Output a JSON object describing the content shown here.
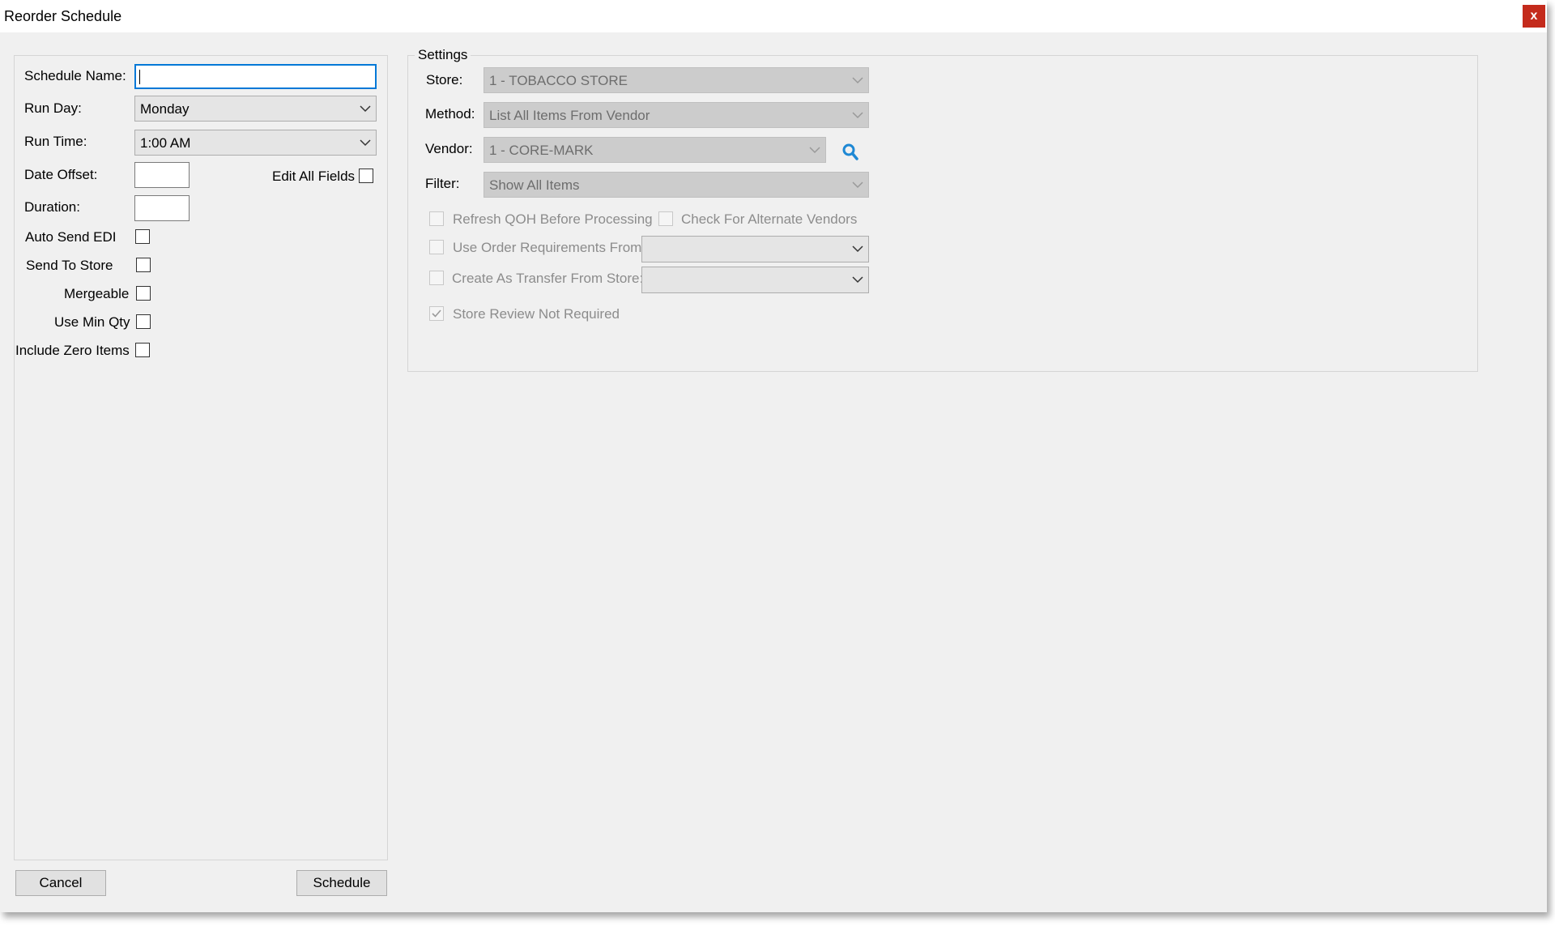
{
  "window": {
    "title": "Reorder Schedule",
    "close_label": "x"
  },
  "left": {
    "schedule_name_label": "Schedule Name:",
    "schedule_name_value": "",
    "run_day_label": "Run Day:",
    "run_day_value": "Monday",
    "run_time_label": "Run Time:",
    "run_time_value": "1:00 AM",
    "date_offset_label": "Date Offset:",
    "date_offset_value": "",
    "edit_all_fields_label": "Edit All Fields",
    "duration_label": "Duration:",
    "duration_value": "",
    "auto_send_edi_label": "Auto Send EDI",
    "send_to_store_label": "Send To Store",
    "mergeable_label": "Mergeable",
    "use_min_qty_label": "Use Min Qty",
    "include_zero_items_label": "Include Zero Items"
  },
  "settings": {
    "title": "Settings",
    "store_label": "Store:",
    "store_value": "1 - TOBACCO STORE",
    "method_label": "Method:",
    "method_value": "List All Items From Vendor",
    "vendor_label": "Vendor:",
    "vendor_value": "1 - CORE-MARK",
    "filter_label": "Filter:",
    "filter_value": "Show All Items",
    "refresh_qoh_label": "Refresh QOH Before Processing",
    "check_alt_vendors_label": "Check For Alternate Vendors",
    "use_order_req_label": "Use Order Requirements From:",
    "use_order_req_value": "",
    "create_transfer_label": "Create As Transfer From Store:",
    "create_transfer_value": "",
    "store_review_label": "Store Review Not Required"
  },
  "buttons": {
    "cancel": "Cancel",
    "schedule": "Schedule"
  },
  "colors": {
    "accent": "#0078d7",
    "close": "#c42b1c",
    "search_icon": "#1e88d4"
  },
  "state": {
    "edit_all_fields_checked": false,
    "auto_send_edi_checked": false,
    "send_to_store_checked": false,
    "mergeable_checked": false,
    "use_min_qty_checked": false,
    "include_zero_items_checked": false,
    "refresh_qoh_checked": false,
    "check_alt_vendors_checked": false,
    "use_order_req_checked": false,
    "create_transfer_checked": false,
    "store_review_checked": true
  }
}
